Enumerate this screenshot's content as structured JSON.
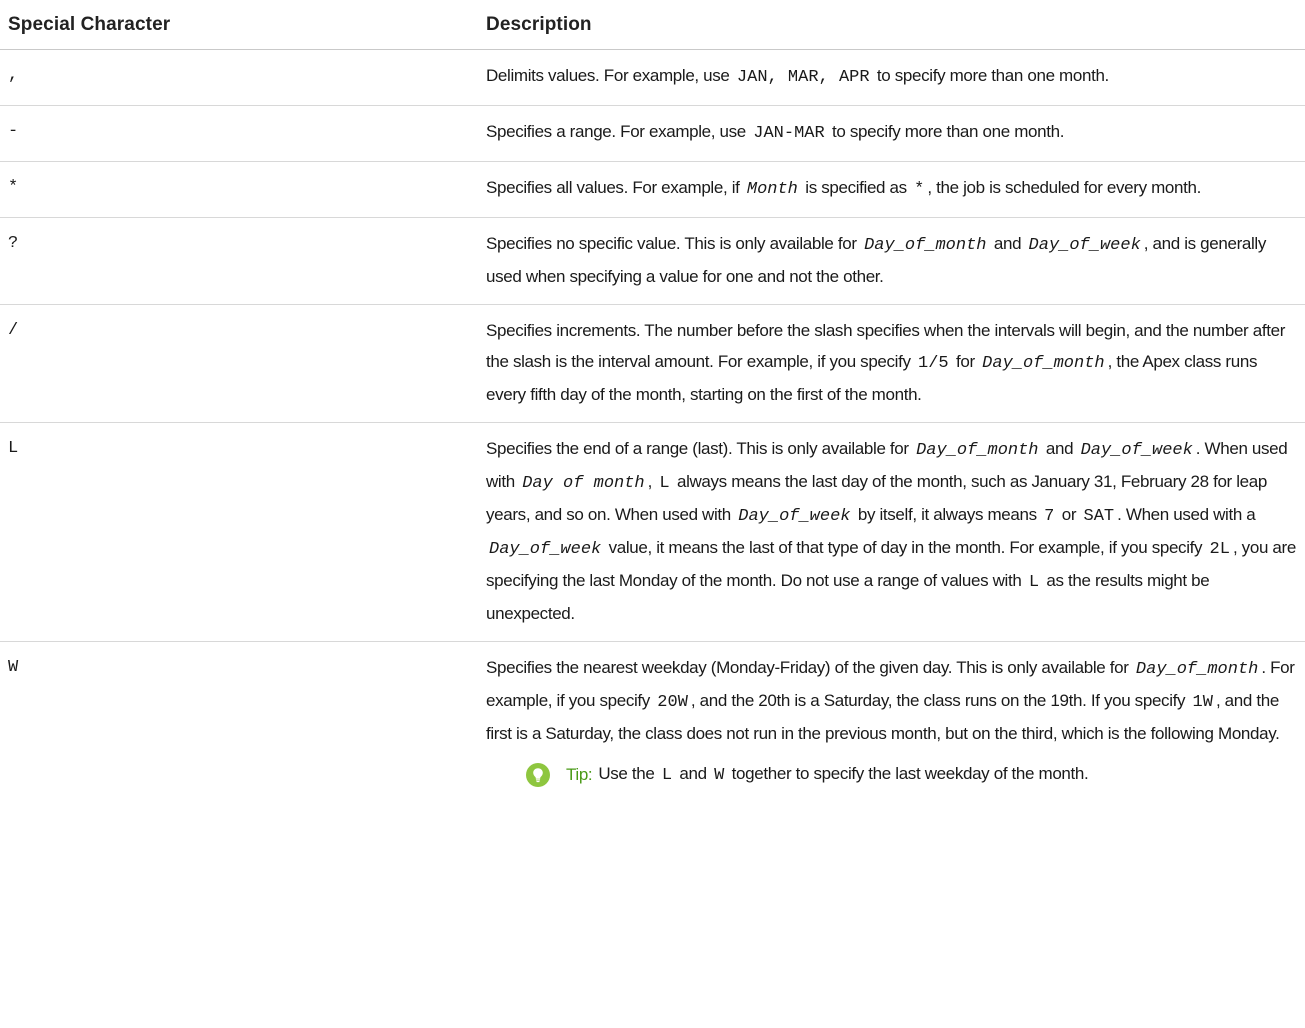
{
  "table": {
    "header": {
      "col1": "Special Character",
      "col2": "Description"
    },
    "rows": [
      {
        "char": ",",
        "desc": [
          {
            "t": "Delimits values. For example, use "
          },
          {
            "code": "JAN, MAR, APR"
          },
          {
            "t": " to specify more than one month."
          }
        ]
      },
      {
        "char": "-",
        "desc": [
          {
            "t": "Specifies a range. For example, use "
          },
          {
            "code": "JAN-MAR"
          },
          {
            "t": " to specify more than one month."
          }
        ]
      },
      {
        "char": "*",
        "desc": [
          {
            "t": "Specifies all values. For example, if "
          },
          {
            "var": "Month"
          },
          {
            "t": " is specified as "
          },
          {
            "code": "*"
          },
          {
            "t": ", the job is scheduled for every month."
          }
        ]
      },
      {
        "char": "?",
        "desc": [
          {
            "t": "Specifies no specific value. This is only available for "
          },
          {
            "var": "Day_of_month"
          },
          {
            "t": " and "
          },
          {
            "var": "Day_of_week"
          },
          {
            "t": ", and is generally used when specifying a value for one and not the other."
          }
        ]
      },
      {
        "char": "/",
        "desc": [
          {
            "t": "Specifies increments. The number before the slash specifies when the intervals will begin, and the number after the slash is the interval amount. For example, if you specify "
          },
          {
            "code": "1/5"
          },
          {
            "t": " for "
          },
          {
            "var": "Day_of_month"
          },
          {
            "t": ", the Apex class runs every fifth day of the month, starting on the first of the month."
          }
        ]
      },
      {
        "char": "L",
        "desc": [
          {
            "t": "Specifies the end of a range (last). This is only available for "
          },
          {
            "var": "Day_of_month"
          },
          {
            "t": " and "
          },
          {
            "var": "Day_of_week"
          },
          {
            "t": ". When used with "
          },
          {
            "var": "Day of month"
          },
          {
            "t": ", "
          },
          {
            "code": "L"
          },
          {
            "t": " always means the last day of the month, such as January 31, February 28 for leap years, and so on. When used with "
          },
          {
            "var": "Day_of_week"
          },
          {
            "t": " by itself, it always means "
          },
          {
            "code": "7"
          },
          {
            "t": " or "
          },
          {
            "code": "SAT"
          },
          {
            "t": ". When used with a "
          },
          {
            "var": "Day_of_week"
          },
          {
            "t": " value, it means the last of that type of day in the month. For example, if you specify "
          },
          {
            "code": "2L"
          },
          {
            "t": ", you are specifying the last Monday of the month. Do not use a range of values with "
          },
          {
            "code": "L"
          },
          {
            "t": " as the results might be unexpected."
          }
        ]
      },
      {
        "char": "W",
        "desc": [
          {
            "t": "Specifies the nearest weekday (Monday-Friday) of the given day. This is only available for "
          },
          {
            "var": "Day_of_month"
          },
          {
            "t": ". For example, if you specify "
          },
          {
            "code": "20W"
          },
          {
            "t": ", and the 20th is a Saturday, the class runs on the 19th. If you specify "
          },
          {
            "code": "1W"
          },
          {
            "t": ", and the first is a Saturday, the class does not run in the previous month, but on the third, which is the following Monday."
          }
        ],
        "tip": {
          "label": "Tip:",
          "content": [
            {
              "t": "Use the "
            },
            {
              "code": "L"
            },
            {
              "t": " and "
            },
            {
              "code": "W"
            },
            {
              "t": " together to specify the last weekday of the month."
            }
          ]
        }
      }
    ]
  },
  "colors": {
    "tip_icon": "#8ec63f",
    "tip_label": "#4a9a17",
    "rule": "#d8d8d8"
  },
  "icons": {
    "tip": "lightbulb-icon"
  }
}
